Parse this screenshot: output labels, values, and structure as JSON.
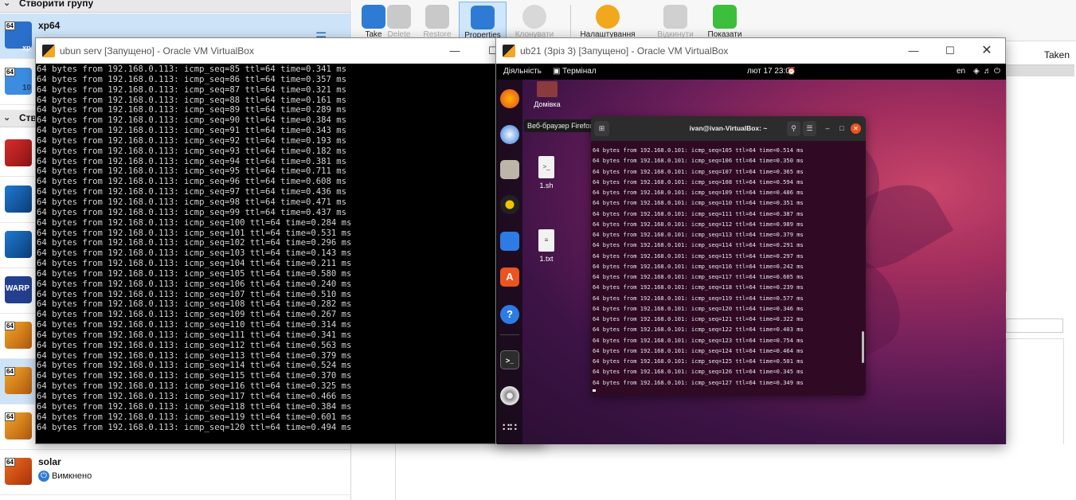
{
  "manager": {
    "groups": [
      {
        "label": "Створити групу"
      },
      {
        "label": "Ств"
      }
    ],
    "vms": [
      {
        "name": "xp64",
        "badge": "64",
        "tag": "xp"
      },
      {
        "name": "",
        "badge": "64",
        "tag": "10"
      },
      {
        "name": "",
        "badge": "",
        "tag": ""
      },
      {
        "name": "",
        "badge": "",
        "tag": ""
      },
      {
        "name": "",
        "badge": "",
        "tag": ""
      },
      {
        "name": "",
        "badge": "",
        "tag": "WARP"
      },
      {
        "name": "",
        "badge": "64",
        "tag": ""
      },
      {
        "name": "",
        "badge": "64",
        "tag": ""
      },
      {
        "name": "",
        "badge": "64",
        "tag": ""
      },
      {
        "name": "solar",
        "badge": "64",
        "tag": "",
        "status": "Вимкнено"
      }
    ],
    "toolbar": [
      {
        "label": "Take",
        "icon": "camera-plus-icon",
        "state": "normal"
      },
      {
        "label": "Delete",
        "icon": "camera-delete-icon",
        "state": "disabled"
      },
      {
        "label": "Restore",
        "icon": "camera-restore-icon",
        "state": "disabled"
      },
      {
        "label": "Properties",
        "icon": "camera-properties-icon",
        "state": "active"
      },
      {
        "label": "Клонувати",
        "icon": "sheep-clone-icon",
        "state": "disabled"
      },
      {
        "label": "Налаштування",
        "icon": "gear-icon",
        "state": "normal"
      },
      {
        "label": "Відкинути",
        "icon": "arrow-down-icon",
        "state": "disabled"
      },
      {
        "label": "Показати",
        "icon": "arrow-right-icon",
        "state": "normal"
      }
    ],
    "snapshot_column": "Taken"
  },
  "ubun": {
    "title": "ubun serv [Запущено] - Oracle VM VirtualBox",
    "host": "192.168.0.113",
    "lines": [
      {
        "seq": 85,
        "time": "0.341"
      },
      {
        "seq": 86,
        "time": "0.357"
      },
      {
        "seq": 87,
        "time": "0.321"
      },
      {
        "seq": 88,
        "time": "0.161"
      },
      {
        "seq": 89,
        "time": "0.289"
      },
      {
        "seq": 90,
        "time": "0.384"
      },
      {
        "seq": 91,
        "time": "0.343"
      },
      {
        "seq": 92,
        "time": "0.193"
      },
      {
        "seq": 93,
        "time": "0.182"
      },
      {
        "seq": 94,
        "time": "0.381"
      },
      {
        "seq": 95,
        "time": "0.711"
      },
      {
        "seq": 96,
        "time": "0.608"
      },
      {
        "seq": 97,
        "time": "0.436"
      },
      {
        "seq": 98,
        "time": "0.471"
      },
      {
        "seq": 99,
        "time": "0.437"
      },
      {
        "seq": 100,
        "time": "0.284"
      },
      {
        "seq": 101,
        "time": "0.531"
      },
      {
        "seq": 102,
        "time": "0.296"
      },
      {
        "seq": 103,
        "time": "0.143"
      },
      {
        "seq": 104,
        "time": "0.211"
      },
      {
        "seq": 105,
        "time": "0.580"
      },
      {
        "seq": 106,
        "time": "0.240"
      },
      {
        "seq": 107,
        "time": "0.510"
      },
      {
        "seq": 108,
        "time": "0.282"
      },
      {
        "seq": 109,
        "time": "0.267"
      },
      {
        "seq": 110,
        "time": "0.314"
      },
      {
        "seq": 111,
        "time": "0.341"
      },
      {
        "seq": 112,
        "time": "0.563"
      },
      {
        "seq": 113,
        "time": "0.379"
      },
      {
        "seq": 114,
        "time": "0.524"
      },
      {
        "seq": 115,
        "time": "0.370"
      },
      {
        "seq": 116,
        "time": "0.325"
      },
      {
        "seq": 117,
        "time": "0.466"
      },
      {
        "seq": 118,
        "time": "0.384"
      },
      {
        "seq": 119,
        "time": "0.601"
      },
      {
        "seq": 120,
        "time": "0.494"
      }
    ]
  },
  "ub21": {
    "title": "ub21 (Зріз 3) [Запущено] - Oracle VM VirtualBox",
    "topbar": {
      "activities": "Діяльність",
      "app": "Термінал",
      "clock": "лют 17  23:01",
      "lang": "en"
    },
    "tooltip": "Веб-браузер Firefox",
    "desktop_files": [
      {
        "label": "Домівка",
        "kind": "folder"
      },
      {
        "label": "1.sh",
        "kind": "script"
      },
      {
        "label": "1.txt",
        "kind": "text"
      }
    ],
    "terminal": {
      "title": "ivan@ivan-VirtualBox: ~",
      "host": "192.168.0.101",
      "lines": [
        {
          "seq": 105,
          "time": "0.514"
        },
        {
          "seq": 106,
          "time": "0.350"
        },
        {
          "seq": 107,
          "time": "0.365"
        },
        {
          "seq": 108,
          "time": "0.594"
        },
        {
          "seq": 109,
          "time": "0.486"
        },
        {
          "seq": 110,
          "time": "0.351"
        },
        {
          "seq": 111,
          "time": "0.387"
        },
        {
          "seq": 112,
          "time": "0.989"
        },
        {
          "seq": 113,
          "time": "0.379"
        },
        {
          "seq": 114,
          "time": "0.291"
        },
        {
          "seq": 115,
          "time": "0.297"
        },
        {
          "seq": 116,
          "time": "0.242"
        },
        {
          "seq": 117,
          "time": "0.605"
        },
        {
          "seq": 118,
          "time": "0.239"
        },
        {
          "seq": 119,
          "time": "0.577"
        },
        {
          "seq": 120,
          "time": "0.346"
        },
        {
          "seq": 121,
          "time": "0.322"
        },
        {
          "seq": 122,
          "time": "0.403"
        },
        {
          "seq": 123,
          "time": "0.754"
        },
        {
          "seq": 124,
          "time": "0.464"
        },
        {
          "seq": 125,
          "time": "0.501"
        },
        {
          "seq": 126,
          "time": "0.345"
        },
        {
          "seq": 127,
          "time": "0.349"
        }
      ]
    }
  }
}
